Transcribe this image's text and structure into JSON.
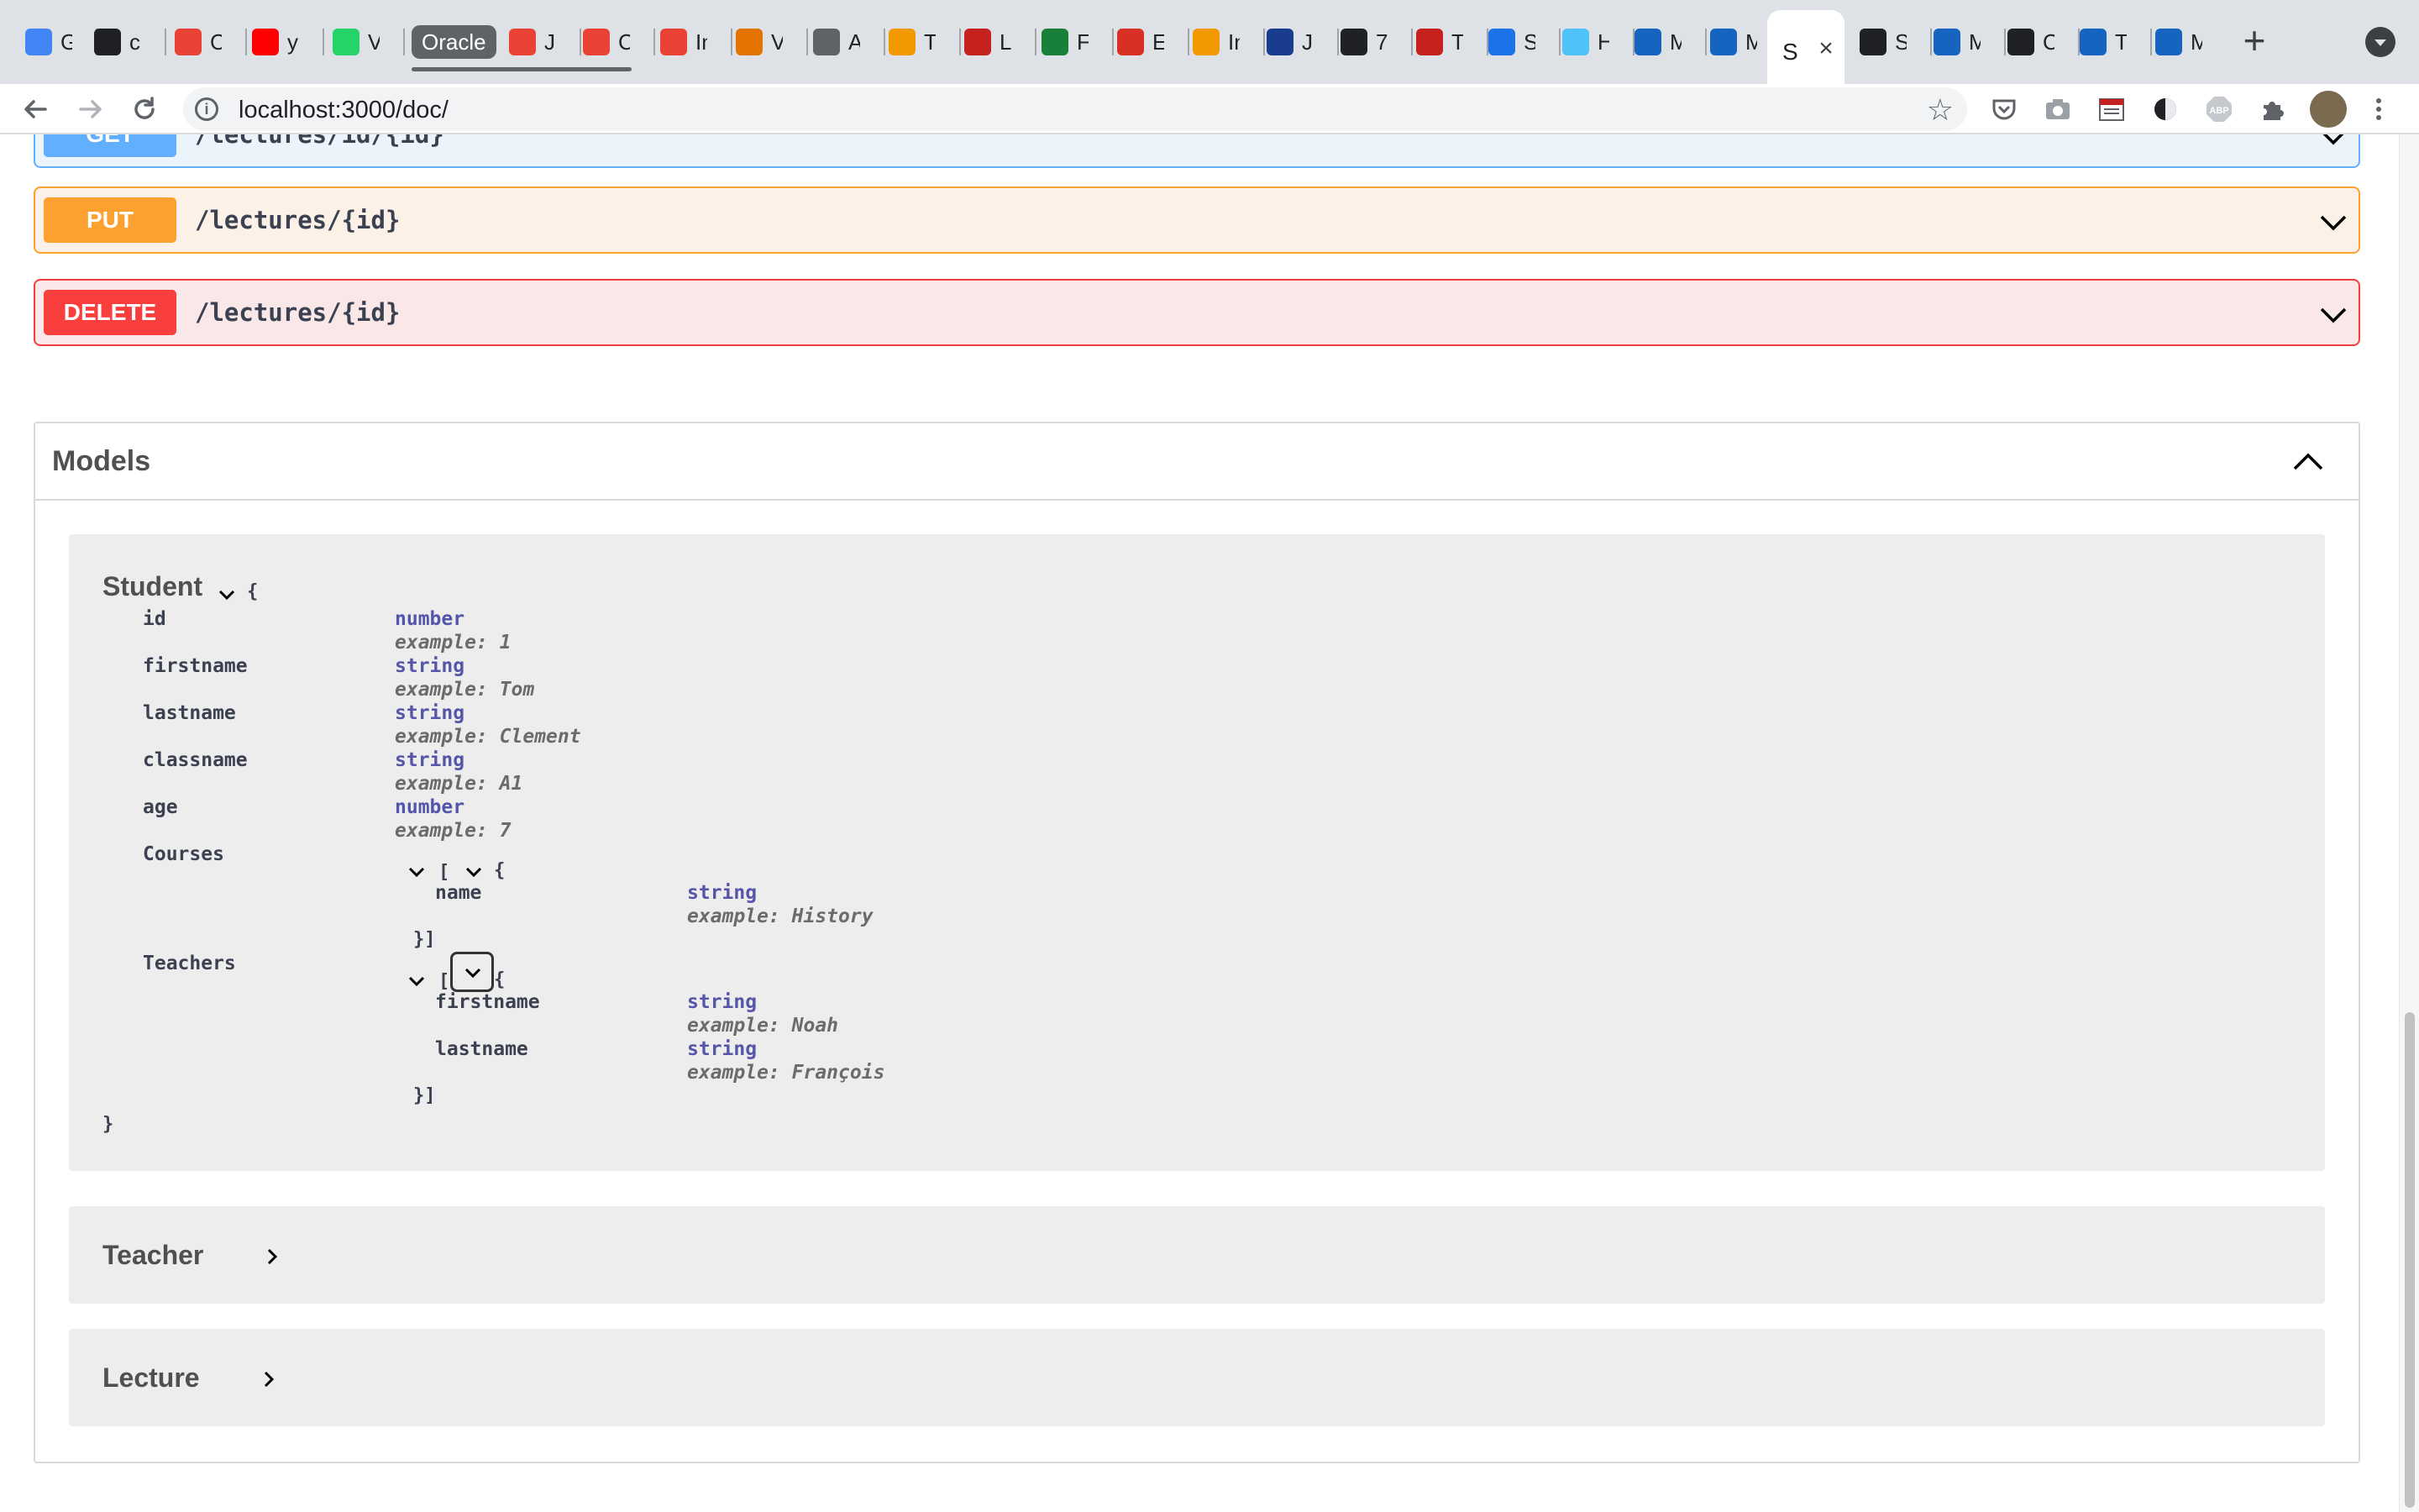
{
  "browser": {
    "tabs": [
      {
        "icon": "google-icon",
        "label": "G",
        "color": "#4285f4"
      },
      {
        "icon": "lambda-icon",
        "label": "c",
        "color": "#202124"
      },
      {
        "icon": "chrome-c-icon",
        "label": "C",
        "color": "#ea4335"
      },
      {
        "icon": "youtube-icon",
        "label": "y",
        "color": "#ff0000"
      },
      {
        "icon": "whatsapp-icon",
        "label": "V",
        "color": "#25d366"
      },
      {
        "icon": "oracle-icon",
        "label": "J",
        "color": "#ea4335"
      },
      {
        "icon": "oracle-icon",
        "label": "C",
        "color": "#ea4335"
      },
      {
        "icon": "gmail-icon",
        "label": "In",
        "color": "#ea4335"
      },
      {
        "icon": "contact-icon",
        "label": "V",
        "color": "#e37400"
      },
      {
        "icon": "globe-icon",
        "label": "A",
        "color": "#5f6368"
      },
      {
        "icon": "bookmark-icon",
        "label": "T",
        "color": "#f29900"
      },
      {
        "icon": "java-icon",
        "label": "L",
        "color": "#c5221f"
      },
      {
        "icon": "doc-icon",
        "label": "F",
        "color": "#188038"
      },
      {
        "icon": "octopus-icon",
        "label": "E",
        "color": "#d93025"
      },
      {
        "icon": "letter-d-icon",
        "label": "In",
        "color": "#f29900"
      },
      {
        "icon": "bank-icon",
        "label": "J",
        "color": "#1a3c8e"
      },
      {
        "icon": "job-icon",
        "label": "7",
        "color": "#202124"
      },
      {
        "icon": "java-icon",
        "label": "T",
        "color": "#c5221f"
      },
      {
        "icon": "c-logo-icon",
        "label": "S",
        "color": "#1a73e8"
      },
      {
        "icon": "web-icon",
        "label": "H",
        "color": "#4fc3f7"
      },
      {
        "icon": "cube-icon",
        "label": "M",
        "color": "#1565c0"
      },
      {
        "icon": "cube-icon",
        "label": "M",
        "color": "#1565c0"
      },
      {
        "icon": "square-icon",
        "label": "S",
        "color": "#202124"
      },
      {
        "icon": "cube-icon",
        "label": "M",
        "color": "#1565c0"
      },
      {
        "icon": "github-icon",
        "label": "C",
        "color": "#202124"
      },
      {
        "icon": "cube-icon",
        "label": "T",
        "color": "#1565c0"
      },
      {
        "icon": "cube-icon",
        "label": "M",
        "color": "#1565c0"
      }
    ],
    "tab_group_label": "Oracle",
    "active_tab_label": "S",
    "url": "localhost:3000/doc/"
  },
  "operations": [
    {
      "method": "GET",
      "path": "/lectures/id/{id}"
    },
    {
      "method": "PUT",
      "path": "/lectures/{id}"
    },
    {
      "method": "DELETE",
      "path": "/lectures/{id}"
    }
  ],
  "models": {
    "title": "Models",
    "student": {
      "name": "Student",
      "open_brace": "{",
      "close_brace": "}",
      "example_prefix": "example:",
      "properties": [
        {
          "name": "id",
          "type": "number",
          "example": "1"
        },
        {
          "name": "firstname",
          "type": "string",
          "example": "Tom"
        },
        {
          "name": "lastname",
          "type": "string",
          "example": "Clement"
        },
        {
          "name": "classname",
          "type": "string",
          "example": "A1"
        },
        {
          "name": "age",
          "type": "number",
          "example": "7"
        }
      ],
      "courses": {
        "name": "Courses",
        "open": "[",
        "obj_open": "{",
        "close": "}]",
        "properties": [
          {
            "name": "name",
            "type": "string",
            "example": "History"
          }
        ]
      },
      "teachers": {
        "name": "Teachers",
        "open": "[",
        "obj_open": "{",
        "close": "}]",
        "properties": [
          {
            "name": "firstname",
            "type": "string",
            "example": "Noah"
          },
          {
            "name": "lastname",
            "type": "string",
            "example": "François"
          }
        ]
      }
    },
    "teacher": {
      "name": "Teacher"
    },
    "lecture": {
      "name": "Lecture"
    }
  },
  "colors": {
    "get": "#61affe",
    "put": "#fca130",
    "delete": "#f93e3e",
    "type": "#5555aa"
  }
}
